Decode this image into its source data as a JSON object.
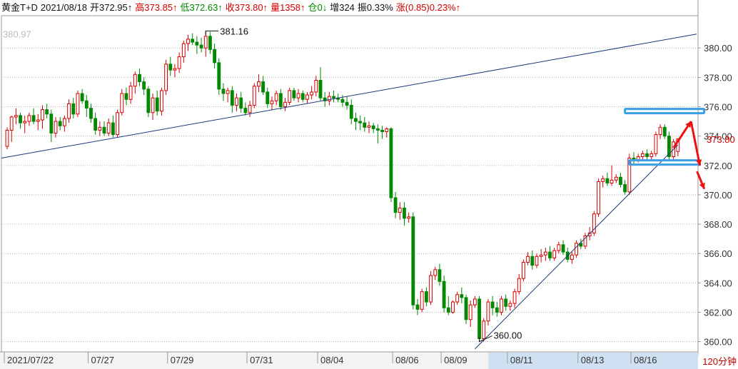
{
  "header": {
    "symbol": "黄金T+D",
    "date": "2021/08/18",
    "open": "开372.95↑",
    "high": "高373.85↑",
    "low": "低372.63↑",
    "close": "收373.80↑",
    "volume": "量1358↑",
    "position": "仓0↓",
    "increase": "增324",
    "amplitude": "振0.33%",
    "change": "涨(0.85)0.23%↑"
  },
  "period_label": "120分钟",
  "colors": {
    "up": "#d40000",
    "down": "#008800",
    "trendline": "#1a3a7a",
    "highlight": "#3aa0e6",
    "arrow": "#ee1111"
  },
  "chart_data": {
    "type": "candlestick",
    "ylim": [
      359.3,
      382.2
    ],
    "yticks": [
      360,
      362,
      364,
      366,
      368,
      370,
      372,
      374,
      376,
      378,
      380
    ],
    "ytick_labels": [
      "360.00",
      "362.00",
      "364.00",
      "366.00",
      "368.00",
      "370.00",
      "372.00",
      "374.00",
      "376.00",
      "378.00",
      "380.00"
    ],
    "top_faded_label": "380.97",
    "current_price_label": "373.80",
    "high_annotation": "381.16",
    "low_annotation": "360.00",
    "date_labels": [
      {
        "i": 0,
        "text": "2021/07/22"
      },
      {
        "i": 19,
        "text": "07/27"
      },
      {
        "i": 37,
        "text": "07/29"
      },
      {
        "i": 55,
        "text": "07/31"
      },
      {
        "i": 71,
        "text": "08/04"
      },
      {
        "i": 88,
        "text": "08/06"
      },
      {
        "i": 99,
        "text": "08/09"
      },
      {
        "i": 114,
        "text": "08/11"
      },
      {
        "i": 130,
        "text": "08/13"
      },
      {
        "i": 142,
        "text": "08/16"
      }
    ],
    "candles": [
      [
        373.3,
        374.6,
        373.1,
        374.4
      ],
      [
        374.4,
        375.4,
        373.6,
        375.3
      ],
      [
        375.3,
        375.9,
        374.8,
        375.4
      ],
      [
        375.4,
        375.6,
        374.5,
        374.9
      ],
      [
        374.9,
        375.4,
        374.2,
        375.0
      ],
      [
        375.0,
        375.6,
        374.7,
        375.4
      ],
      [
        375.4,
        375.9,
        374.8,
        375.0
      ],
      [
        375.0,
        375.5,
        374.4,
        375.1
      ],
      [
        375.1,
        376.1,
        374.5,
        375.8
      ],
      [
        375.8,
        376.2,
        375.2,
        375.5
      ],
      [
        375.5,
        375.8,
        373.6,
        374.2
      ],
      [
        374.2,
        375.3,
        373.9,
        375.0
      ],
      [
        375.0,
        375.3,
        374.4,
        374.7
      ],
      [
        374.7,
        375.4,
        374.3,
        375.2
      ],
      [
        375.2,
        376.5,
        374.9,
        376.2
      ],
      [
        376.2,
        376.6,
        375.2,
        375.5
      ],
      [
        375.5,
        377.1,
        375.3,
        376.9
      ],
      [
        376.9,
        377.2,
        376.2,
        376.4
      ],
      [
        376.4,
        376.8,
        375.3,
        375.9
      ],
      [
        375.9,
        376.2,
        374.9,
        375.2
      ],
      [
        375.2,
        375.6,
        374.1,
        374.4
      ],
      [
        374.4,
        375.0,
        374.0,
        374.6
      ],
      [
        374.6,
        375.0,
        374.0,
        374.2
      ],
      [
        374.2,
        375.2,
        374.0,
        374.9
      ],
      [
        374.9,
        375.4,
        373.9,
        374.1
      ],
      [
        374.1,
        375.8,
        373.9,
        375.6
      ],
      [
        375.6,
        377.2,
        375.4,
        376.9
      ],
      [
        376.9,
        377.3,
        376.1,
        376.5
      ],
      [
        376.5,
        377.7,
        376.2,
        377.4
      ],
      [
        377.4,
        378.4,
        376.9,
        378.2
      ],
      [
        378.2,
        378.6,
        377.4,
        377.7
      ],
      [
        377.7,
        378.0,
        376.8,
        377.2
      ],
      [
        377.2,
        377.4,
        375.3,
        375.6
      ],
      [
        375.6,
        376.9,
        375.1,
        376.6
      ],
      [
        376.6,
        377.1,
        375.4,
        375.7
      ],
      [
        375.7,
        377.3,
        375.4,
        377.1
      ],
      [
        377.1,
        379.2,
        376.8,
        378.9
      ],
      [
        378.9,
        379.4,
        378.1,
        378.5
      ],
      [
        378.5,
        378.9,
        378.0,
        378.6
      ],
      [
        378.6,
        379.7,
        378.3,
        379.4
      ],
      [
        379.4,
        380.5,
        379.0,
        380.3
      ],
      [
        380.3,
        380.9,
        379.8,
        380.6
      ],
      [
        380.6,
        381.0,
        380.2,
        380.4
      ],
      [
        380.4,
        380.8,
        379.6,
        380.2
      ],
      [
        380.2,
        380.7,
        379.7,
        380.0
      ],
      [
        380.0,
        381.16,
        379.4,
        380.8
      ],
      [
        380.8,
        381.1,
        379.6,
        379.9
      ],
      [
        379.9,
        380.3,
        378.6,
        379.0
      ],
      [
        379.0,
        379.3,
        376.8,
        377.2
      ],
      [
        377.2,
        377.6,
        376.4,
        376.9
      ],
      [
        376.9,
        377.3,
        376.3,
        377.1
      ],
      [
        377.1,
        377.4,
        375.6,
        376.1
      ],
      [
        376.1,
        376.9,
        375.7,
        376.6
      ],
      [
        376.6,
        377.0,
        375.6,
        375.9
      ],
      [
        375.9,
        376.3,
        375.4,
        375.6
      ],
      [
        375.6,
        376.4,
        375.3,
        376.1
      ],
      [
        376.1,
        377.6,
        375.9,
        377.4
      ],
      [
        377.4,
        378.2,
        377.0,
        377.7
      ],
      [
        377.7,
        378.1,
        376.8,
        377.0
      ],
      [
        377.0,
        377.3,
        375.9,
        376.2
      ],
      [
        376.2,
        376.7,
        375.8,
        376.4
      ],
      [
        376.4,
        377.1,
        376.1,
        376.9
      ],
      [
        376.9,
        377.2,
        375.8,
        376.0
      ],
      [
        376.0,
        376.6,
        375.7,
        376.3
      ],
      [
        376.3,
        377.3,
        376.1,
        377.1
      ],
      [
        377.1,
        377.3,
        376.4,
        376.6
      ],
      [
        376.6,
        377.2,
        376.3,
        376.9
      ],
      [
        376.9,
        377.1,
        376.3,
        376.5
      ],
      [
        376.5,
        377.0,
        376.2,
        376.8
      ],
      [
        376.8,
        377.4,
        376.5,
        377.0
      ],
      [
        377.0,
        378.1,
        376.7,
        377.8
      ],
      [
        377.8,
        378.7,
        376.4,
        376.6
      ],
      [
        376.6,
        377.0,
        376.0,
        376.4
      ],
      [
        376.4,
        377.0,
        376.1,
        376.7
      ],
      [
        376.7,
        377.1,
        376.3,
        376.6
      ],
      [
        376.6,
        376.9,
        376.3,
        376.5
      ],
      [
        376.5,
        376.8,
        376.0,
        376.3
      ],
      [
        376.3,
        376.7,
        375.8,
        376.1
      ],
      [
        376.1,
        376.5,
        374.8,
        375.2
      ],
      [
        375.2,
        375.6,
        374.4,
        375.0
      ],
      [
        375.0,
        375.4,
        374.4,
        374.9
      ],
      [
        374.9,
        375.3,
        374.3,
        374.6
      ],
      [
        374.6,
        375.0,
        374.2,
        374.7
      ],
      [
        374.7,
        374.9,
        374.2,
        374.5
      ],
      [
        374.5,
        374.8,
        373.5,
        374.4
      ],
      [
        374.4,
        374.7,
        373.8,
        374.3
      ],
      [
        374.3,
        374.6,
        373.9,
        374.5
      ],
      [
        374.5,
        374.6,
        369.5,
        369.8
      ],
      [
        369.8,
        370.2,
        368.4,
        368.8
      ],
      [
        368.8,
        369.5,
        368.3,
        369.1
      ],
      [
        369.1,
        369.5,
        367.9,
        368.4
      ],
      [
        368.4,
        368.8,
        368.1,
        368.5
      ],
      [
        368.5,
        368.8,
        362.2,
        362.5
      ],
      [
        362.5,
        362.9,
        361.8,
        362.2
      ],
      [
        362.2,
        363.6,
        362.0,
        363.4
      ],
      [
        363.4,
        363.7,
        362.4,
        362.7
      ],
      [
        362.7,
        364.8,
        362.5,
        364.5
      ],
      [
        364.5,
        365.1,
        364.2,
        364.9
      ],
      [
        364.9,
        365.3,
        363.8,
        364.1
      ],
      [
        364.1,
        364.5,
        362.0,
        362.3
      ],
      [
        362.3,
        363.1,
        361.8,
        362.0
      ],
      [
        362.0,
        362.8,
        361.9,
        362.7
      ],
      [
        362.7,
        363.4,
        362.5,
        363.2
      ],
      [
        363.2,
        363.7,
        362.6,
        363.0
      ],
      [
        363.0,
        363.2,
        361.2,
        361.5
      ],
      [
        361.5,
        362.8,
        361.0,
        362.5
      ],
      [
        362.5,
        363.1,
        362.3,
        362.9
      ],
      [
        362.9,
        363.1,
        360.0,
        360.2
      ],
      [
        360.2,
        361.6,
        360.0,
        361.4
      ],
      [
        361.4,
        362.9,
        361.1,
        362.7
      ],
      [
        362.7,
        363.1,
        361.8,
        362.3
      ],
      [
        362.3,
        362.7,
        361.7,
        362.0
      ],
      [
        362.0,
        363.1,
        361.8,
        362.9
      ],
      [
        362.9,
        363.2,
        362.1,
        362.4
      ],
      [
        362.4,
        362.8,
        362.1,
        362.6
      ],
      [
        362.6,
        363.6,
        362.3,
        363.4
      ],
      [
        363.4,
        364.6,
        363.2,
        364.3
      ],
      [
        364.3,
        365.6,
        364.1,
        365.4
      ],
      [
        365.4,
        366.1,
        365.2,
        365.8
      ],
      [
        365.8,
        366.2,
        364.9,
        365.2
      ],
      [
        365.2,
        366.0,
        365.0,
        365.8
      ],
      [
        365.8,
        366.3,
        365.4,
        365.9
      ],
      [
        365.9,
        366.4,
        365.5,
        366.1
      ],
      [
        366.1,
        366.5,
        365.5,
        365.7
      ],
      [
        365.7,
        366.4,
        365.5,
        366.2
      ],
      [
        366.2,
        366.8,
        366.0,
        366.6
      ],
      [
        366.6,
        366.9,
        365.9,
        366.1
      ],
      [
        366.1,
        366.4,
        365.4,
        365.6
      ],
      [
        365.6,
        366.1,
        365.3,
        365.9
      ],
      [
        365.9,
        366.9,
        365.7,
        366.7
      ],
      [
        366.7,
        367.0,
        366.3,
        366.5
      ],
      [
        366.5,
        367.4,
        366.3,
        367.2
      ],
      [
        367.2,
        367.8,
        366.9,
        367.4
      ],
      [
        367.4,
        368.9,
        367.2,
        368.7
      ],
      [
        368.7,
        371.1,
        368.5,
        370.9
      ],
      [
        370.9,
        371.3,
        370.5,
        371.1
      ],
      [
        371.1,
        371.5,
        370.6,
        370.8
      ],
      [
        370.8,
        372.0,
        370.6,
        371.0
      ],
      [
        371.0,
        371.4,
        370.8,
        371.2
      ],
      [
        371.2,
        371.5,
        370.5,
        370.7
      ],
      [
        370.7,
        371.0,
        370.0,
        370.2
      ],
      [
        370.2,
        372.8,
        370.0,
        372.5
      ],
      [
        372.5,
        372.9,
        372.1,
        372.4
      ],
      [
        372.4,
        372.8,
        372.2,
        372.6
      ],
      [
        372.6,
        373.0,
        372.4,
        372.8
      ],
      [
        372.8,
        373.1,
        372.4,
        372.6
      ],
      [
        372.6,
        373.0,
        372.4,
        372.8
      ],
      [
        372.8,
        374.3,
        372.6,
        374.1
      ],
      [
        374.1,
        374.8,
        373.8,
        374.6
      ],
      [
        374.6,
        374.8,
        373.8,
        374.0
      ],
      [
        374.0,
        374.3,
        372.4,
        372.6
      ],
      [
        372.6,
        373.8,
        372.4,
        373.6
      ],
      [
        372.95,
        373.85,
        372.63,
        373.8
      ]
    ]
  }
}
